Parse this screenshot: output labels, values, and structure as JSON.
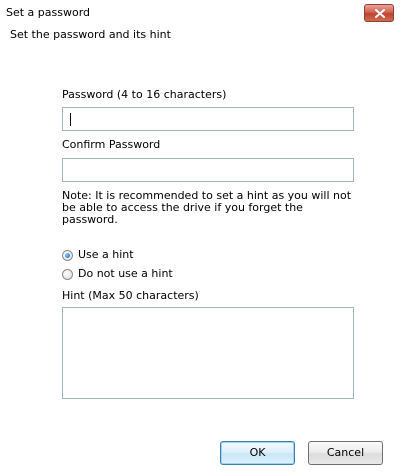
{
  "dialog": {
    "title": "Set a password",
    "heading": "Set the password and its hint"
  },
  "password": {
    "label": "Password (4 to 16 characters)",
    "value": ""
  },
  "confirm_password": {
    "label": "Confirm Password",
    "value": ""
  },
  "note": "Note: It is recommended to set a hint as you will not be able to access the drive if you forget the password.",
  "hint_options": [
    {
      "label": "Use a hint",
      "selected": true
    },
    {
      "label": "Do not use a hint",
      "selected": false
    }
  ],
  "hint": {
    "label": "Hint (Max 50 characters)",
    "value": ""
  },
  "buttons": {
    "ok": "OK",
    "cancel": "Cancel"
  },
  "icons": {
    "close": "close-icon"
  },
  "colors": {
    "close_button": "#c0412d",
    "input_border": "#a0b4c8",
    "radio_selected": "#2a7dd8"
  }
}
